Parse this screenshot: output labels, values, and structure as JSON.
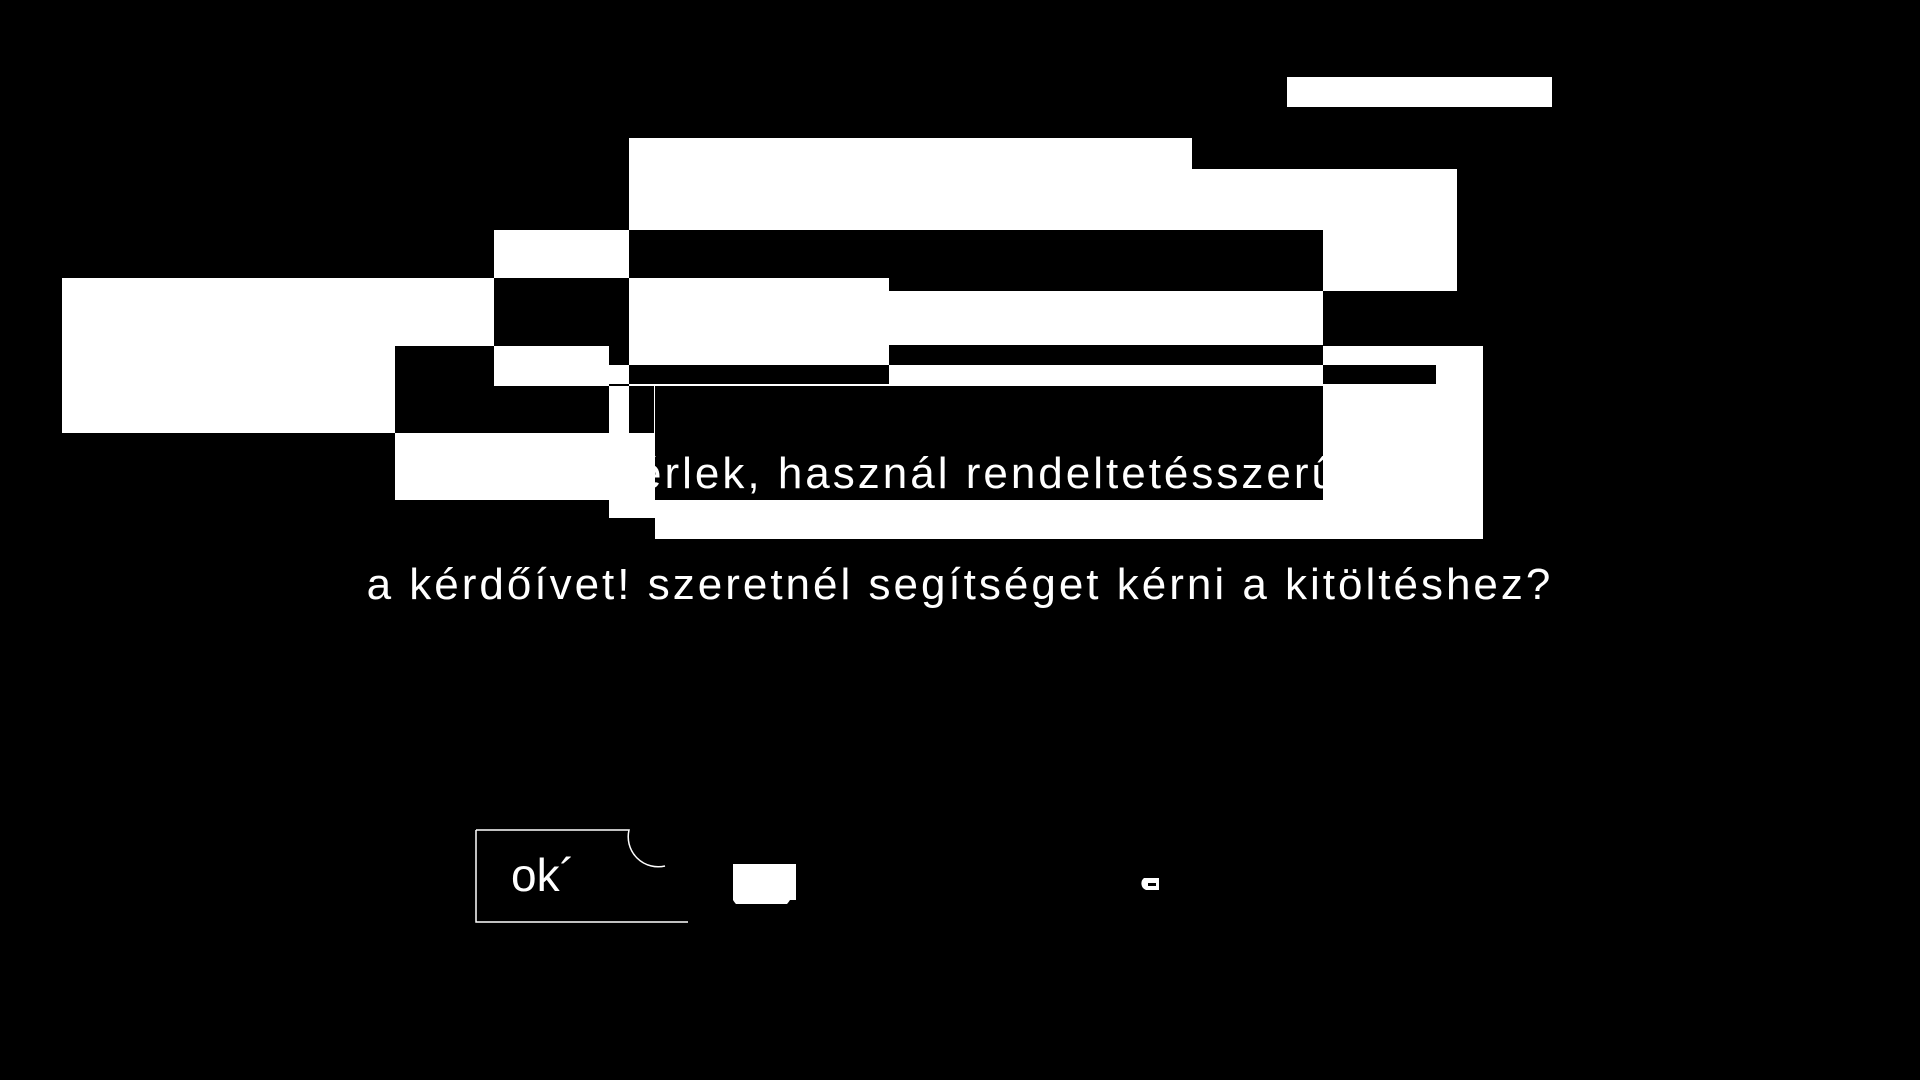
{
  "dialog": {
    "message_line1": "kérlek, használ rendeltetésszerűen",
    "message_line2": "a kérdőívet! szeretnél segítséget kérni a kitöltéshez?",
    "ok_label": "ok´"
  },
  "colors": {
    "background": "#000000",
    "foreground": "#ffffff"
  },
  "decor": {
    "icons": [
      "half-circle-icon",
      "small-glyph-icon"
    ]
  }
}
